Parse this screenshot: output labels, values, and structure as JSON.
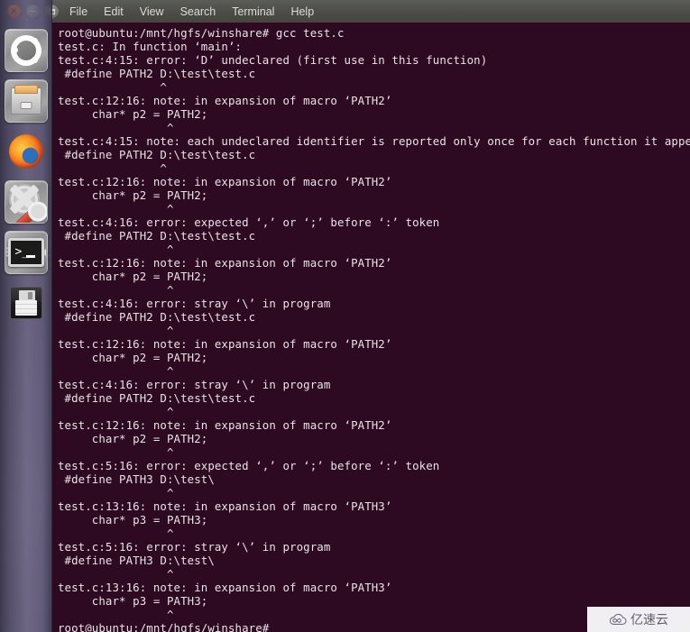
{
  "desktop": {
    "launcher": {
      "items": [
        {
          "name": "ubuntu-dash",
          "label": "Ubuntu Dash Home",
          "icon": "ubuntu-logo-icon",
          "active": false
        },
        {
          "name": "files",
          "label": "Files",
          "icon": "file-cabinet-icon",
          "active": false
        },
        {
          "name": "firefox",
          "label": "Firefox Web Browser",
          "icon": "firefox-icon",
          "active": false
        },
        {
          "name": "settings",
          "label": "System Settings",
          "icon": "gear-wrench-icon",
          "active": false
        },
        {
          "name": "terminal",
          "label": "Terminal",
          "icon": "terminal-icon",
          "active": true
        },
        {
          "name": "save-disk",
          "label": "Save",
          "icon": "floppy-disk-icon",
          "active": false
        }
      ]
    }
  },
  "window": {
    "buttons": {
      "close": "×",
      "minimize": "−",
      "maximize": "□"
    },
    "menu": [
      {
        "label": "File"
      },
      {
        "label": "Edit"
      },
      {
        "label": "View"
      },
      {
        "label": "Search"
      },
      {
        "label": "Terminal"
      },
      {
        "label": "Help"
      }
    ]
  },
  "terminal": {
    "background_color": "#2d0922",
    "foreground_color": "#e8e4e4",
    "prompt": "root@ubuntu:/mnt/hgfs/winshare#",
    "command": "gcc test.c",
    "content": "root@ubuntu:/mnt/hgfs/winshare# gcc test.c\ntest.c: In function ‘main’:\ntest.c:4:15: error: ‘D’ undeclared (first use in this function)\n #define PATH2 D:\\test\\test.c\n               ^\ntest.c:12:16: note: in expansion of macro ‘PATH2’\n     char* p2 = PATH2;\n                ^\ntest.c:4:15: note: each undeclared identifier is reported only once for each function it appears in\n #define PATH2 D:\\test\\test.c\n               ^\ntest.c:12:16: note: in expansion of macro ‘PATH2’\n     char* p2 = PATH2;\n                ^\ntest.c:4:16: error: expected ‘,’ or ‘;’ before ‘:’ token\n #define PATH2 D:\\test\\test.c\n                ^\ntest.c:12:16: note: in expansion of macro ‘PATH2’\n     char* p2 = PATH2;\n                ^\ntest.c:4:16: error: stray ‘\\’ in program\n #define PATH2 D:\\test\\test.c\n                ^\ntest.c:12:16: note: in expansion of macro ‘PATH2’\n     char* p2 = PATH2;\n                ^\ntest.c:4:16: error: stray ‘\\’ in program\n #define PATH2 D:\\test\\test.c\n                ^\ntest.c:12:16: note: in expansion of macro ‘PATH2’\n     char* p2 = PATH2;\n                ^\ntest.c:5:16: error: expected ‘,’ or ‘;’ before ‘:’ token\n #define PATH3 D:\\test\\\n                ^\ntest.c:13:16: note: in expansion of macro ‘PATH3’\n     char* p3 = PATH3;\n                ^\ntest.c:5:16: error: stray ‘\\’ in program\n #define PATH3 D:\\test\\\n                ^\ntest.c:13:16: note: in expansion of macro ‘PATH3’\n     char* p3 = PATH3;\n                ^\nroot@ubuntu:/mnt/hgfs/winshare# "
  },
  "watermark": {
    "text": "亿速云",
    "icon": "cloud-icon",
    "text_color": "#5f5f72",
    "background_color": "#f0f0f2"
  }
}
